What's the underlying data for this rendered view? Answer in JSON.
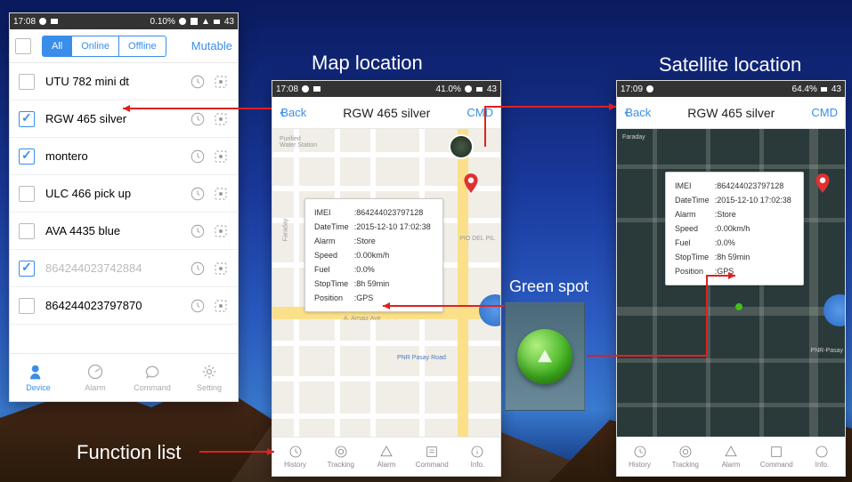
{
  "annotations": {
    "map_location": "Map location",
    "satellite_location": "Satellite location",
    "green_spot": "Green spot",
    "function_list": "Function list"
  },
  "phone1": {
    "status": {
      "time": "17:08",
      "pct": "0.10%",
      "batt": "43"
    },
    "filter": {
      "all": "All",
      "online": "Online",
      "offline": "Offline",
      "mutable": "Mutable"
    },
    "devices": [
      {
        "label": "UTU 782 mini dt",
        "checked": false,
        "dim": false
      },
      {
        "label": "RGW 465 silver",
        "checked": true,
        "dim": false
      },
      {
        "label": "montero",
        "checked": true,
        "dim": false
      },
      {
        "label": "ULC 466 pick up",
        "checked": false,
        "dim": false
      },
      {
        "label": "AVA 4435 blue",
        "checked": false,
        "dim": false
      },
      {
        "label": "864244023742884",
        "checked": true,
        "dim": true
      },
      {
        "label": "864244023797870",
        "checked": false,
        "dim": false
      }
    ],
    "tabs": {
      "device": "Device",
      "alarm": "Alarm",
      "command": "Command",
      "setting": "Setting"
    }
  },
  "phone2": {
    "status": {
      "time": "17:08",
      "pct": "41.0%",
      "batt": "43"
    },
    "nav": {
      "back": "Back",
      "title": "RGW 465 silver",
      "cmd": "CMD"
    },
    "info": {
      "imei_l": "IMEI",
      "imei_v": ":864244023797128",
      "dt_l": "DateTime",
      "dt_v": ":2015-12-10 17:02:38",
      "al_l": "Alarm",
      "al_v": ":Store",
      "sp_l": "Speed",
      "sp_v": ":0.00km/h",
      "fu_l": "Fuel",
      "fu_v": ":0.0%",
      "st_l": "StopTime",
      "st_v": ":8h 59min",
      "po_l": "Position",
      "po_v": ":GPS"
    },
    "map_labels": {
      "water": "Purified\nWater Station",
      "faraday": "Faraday",
      "arnaiz": "A. Arnaiz Ave",
      "pasay": "PNR Pasay Road",
      "pio": "PIO DEL PIL"
    },
    "functabs": {
      "history": "History",
      "tracking": "Tracking",
      "alarm": "Alarm",
      "command": "Command",
      "info": "Info."
    }
  },
  "phone3": {
    "status": {
      "time": "17:09",
      "pct": "64.4%",
      "batt": "43"
    },
    "nav": {
      "back": "Back",
      "title": "RGW 465 silver",
      "cmd": "CMD"
    },
    "info": {
      "imei_l": "IMEI",
      "imei_v": ":864244023797128",
      "dt_l": "DateTime",
      "dt_v": ":2015-12-10 17:02:38",
      "al_l": "Alarm",
      "al_v": ":Store",
      "sp_l": "Speed",
      "sp_v": ":0.00km/h",
      "fu_l": "Fuel",
      "fu_v": ":0.0%",
      "st_l": "StopTime",
      "st_v": ":8h 59min",
      "po_l": "Position",
      "po_v": ":GPS"
    },
    "map_labels": {
      "faraday": "Faraday",
      "pasay": "PNR-Pasay"
    },
    "functabs": {
      "history": "History",
      "tracking": "Tracking",
      "alarm": "Alarm",
      "command": "Command",
      "info": "Info."
    }
  }
}
